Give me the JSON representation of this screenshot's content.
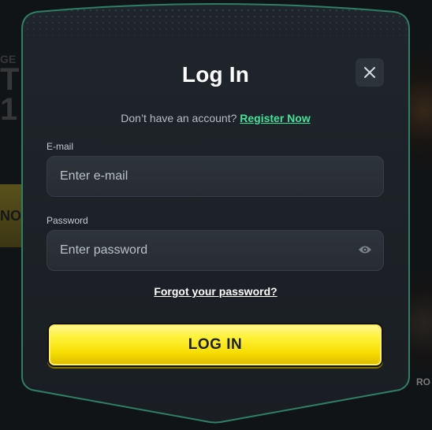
{
  "background": {
    "left_text": "T\n1",
    "left_caption": "GE",
    "left_button_text": "NO",
    "right_label": "RO"
  },
  "modal": {
    "title": "Log In",
    "close_icon": "close-icon",
    "register_prompt": "Don’t have an account?",
    "register_link": "Register Now",
    "email_label": "E-mail",
    "email_placeholder": "Enter e-mail",
    "password_label": "Password",
    "password_placeholder": "Enter password",
    "password_icon": "eye-icon",
    "forgot_link": "Forgot your password?",
    "login_button": "LOG IN"
  },
  "colors": {
    "accent_green": "#3fe39a",
    "button_yellow": "#fff23a",
    "modal_bg": "#1c2127"
  }
}
